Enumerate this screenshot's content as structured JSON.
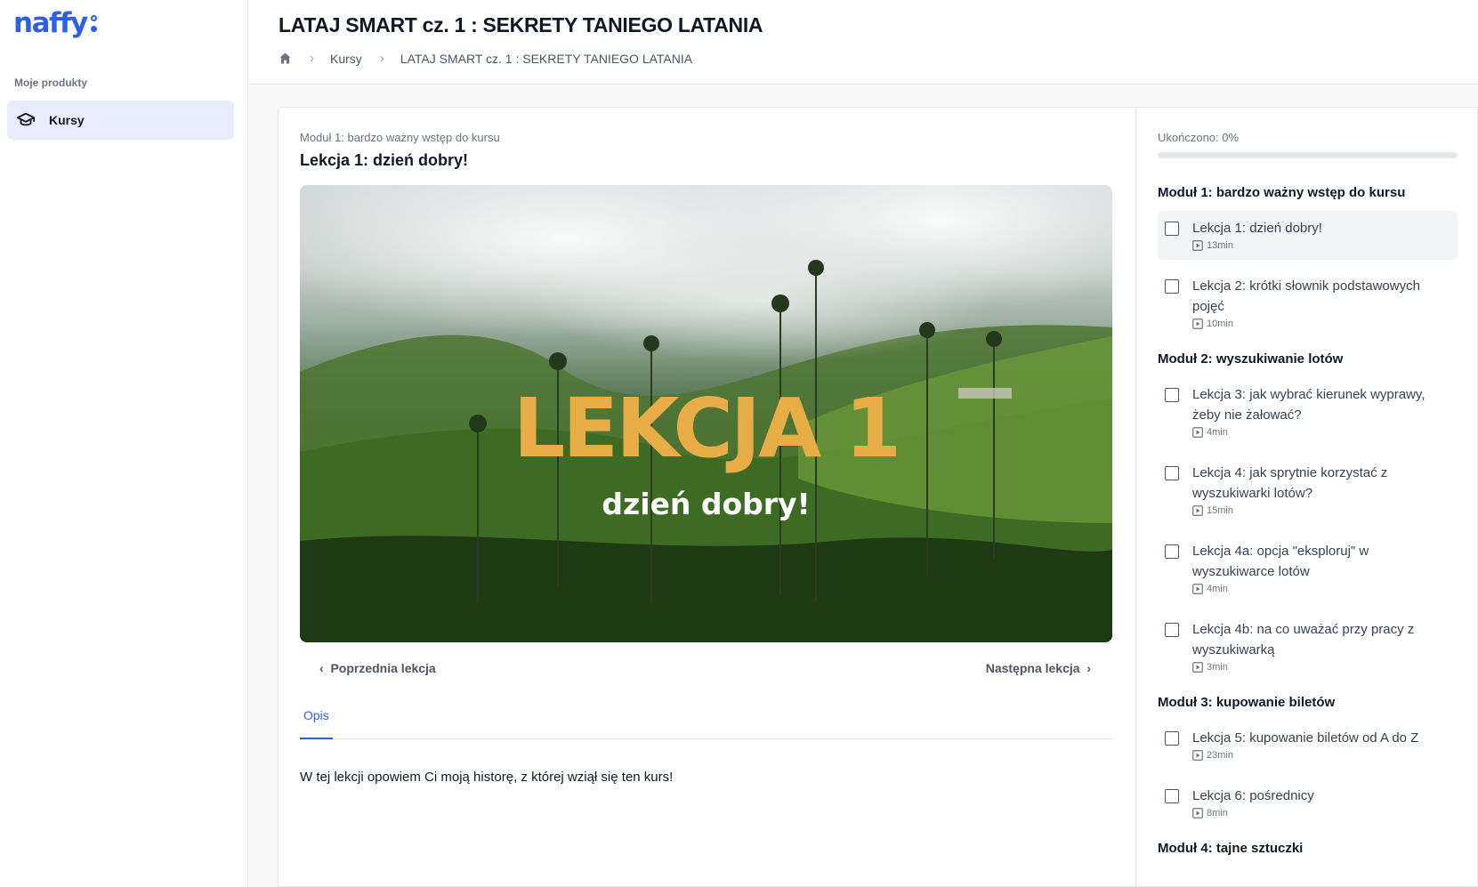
{
  "brand": {
    "logo_text": "naffy",
    "accent": "#2f5fe8"
  },
  "sidebar": {
    "section_label": "Moje produkty",
    "items": [
      {
        "label": "Kursy",
        "icon": "graduation-cap-icon",
        "active": true
      }
    ]
  },
  "header": {
    "title": "LATAJ SMART cz. 1 : SEKRETY TANIEGO LATANIA",
    "breadcrumb": {
      "home_icon": "home-icon",
      "crumbs": [
        "Kursy",
        "LATAJ SMART cz. 1 : SEKRETY TANIEGO LATANIA"
      ]
    }
  },
  "lesson": {
    "module_label": "Moduł 1: bardzo ważny wstęp do kursu",
    "title": "Lekcja 1: dzień dobry!",
    "video": {
      "title": "LEKCJA 1",
      "subtitle": "dzień dobry!"
    },
    "prev_label": "Poprzednia lekcja",
    "next_label": "Następna lekcja",
    "tabs": [
      "Opis"
    ],
    "description": "W tej lekcji opowiem Ci moją historę, z której wziął się ten kurs!"
  },
  "progress": {
    "label": "Ukończono: 0%",
    "value": 0
  },
  "curriculum": {
    "modules": [
      {
        "title": "Moduł 1: bardzo ważny wstęp do kursu",
        "lessons": [
          {
            "title": "Lekcja 1: dzień dobry!",
            "duration": "13min",
            "active": true
          },
          {
            "title": "Lekcja 2: krótki słownik podstawowych pojęć",
            "duration": "10min"
          }
        ]
      },
      {
        "title": "Moduł 2: wyszukiwanie lotów",
        "lessons": [
          {
            "title": "Lekcja 3: jak wybrać kierunek wyprawy, żeby nie żałować?",
            "duration": "4min"
          },
          {
            "title": "Lekcja 4: jak sprytnie korzystać z wyszukiwarki lotów?",
            "duration": "15min"
          },
          {
            "title": "Lekcja 4a: opcja \"eksploruj\" w wyszukiwarce lotów",
            "duration": "4min"
          },
          {
            "title": "Lekcja 4b: na co uważać przy pracy z wyszukiwarką",
            "duration": "3min"
          }
        ]
      },
      {
        "title": "Moduł 3: kupowanie biletów",
        "lessons": [
          {
            "title": "Lekcja 5: kupowanie biletów od A do Z",
            "duration": "23min"
          },
          {
            "title": "Lekcja 6: pośrednicy",
            "duration": "8min"
          }
        ]
      },
      {
        "title": "Moduł 4: tajne sztuczki",
        "lessons": []
      }
    ]
  }
}
